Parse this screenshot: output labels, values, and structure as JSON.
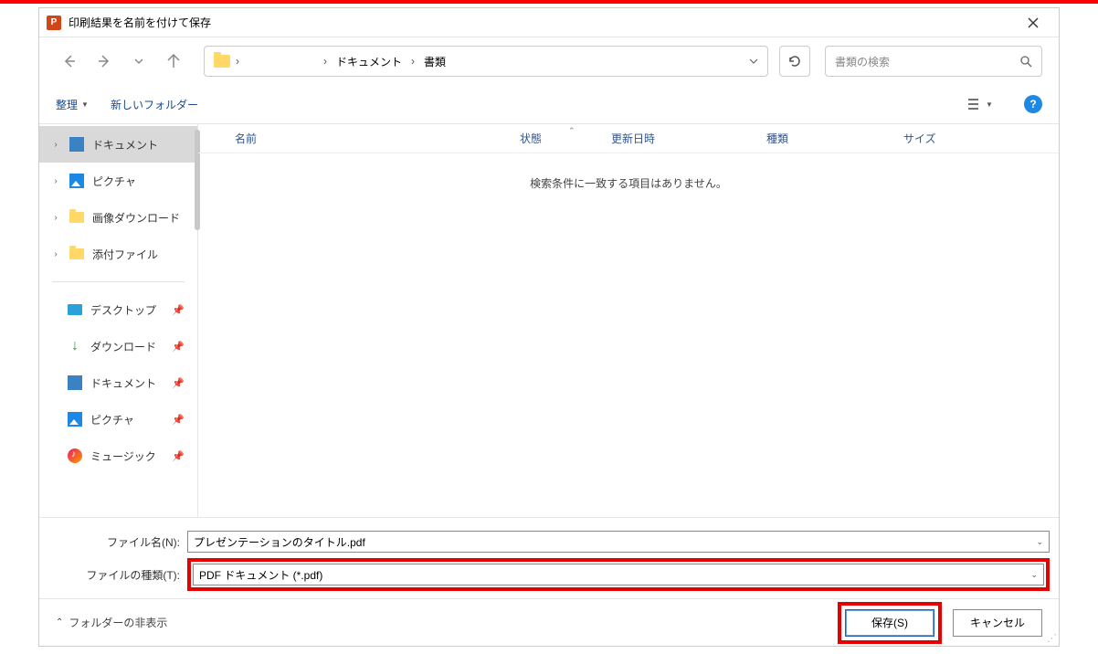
{
  "titlebar": {
    "app_icon_letter": "P",
    "title": "印刷結果を名前を付けて保存"
  },
  "breadcrumb": {
    "parts": [
      "ドキュメント",
      "書類"
    ]
  },
  "search": {
    "placeholder": "書類の検索"
  },
  "toolbar": {
    "organize": "整理",
    "new_folder": "新しいフォルダー"
  },
  "tree": {
    "items": [
      {
        "label": "ドキュメント",
        "icon": "doc",
        "caret": true,
        "selected": true
      },
      {
        "label": "ピクチャ",
        "icon": "pic",
        "caret": true
      },
      {
        "label": "画像ダウンロード",
        "icon": "folder",
        "caret": true
      },
      {
        "label": "添付ファイル",
        "icon": "folder",
        "caret": true
      }
    ],
    "quick": [
      {
        "label": "デスクトップ",
        "icon": "desktop"
      },
      {
        "label": "ダウンロード",
        "icon": "download"
      },
      {
        "label": "ドキュメント",
        "icon": "doc"
      },
      {
        "label": "ピクチャ",
        "icon": "pic"
      },
      {
        "label": "ミュージック",
        "icon": "music"
      }
    ]
  },
  "columns": {
    "name": "名前",
    "status": "状態",
    "date": "更新日時",
    "kind": "種類",
    "size": "サイズ"
  },
  "empty_msg": "検索条件に一致する項目はありません。",
  "form": {
    "filename_label": "ファイル名(N):",
    "filename_value": "プレゼンテーションのタイトル.pdf",
    "filetype_label": "ファイルの種類(T):",
    "filetype_value": "PDF ドキュメント (*.pdf)"
  },
  "footer": {
    "hide_folders": "フォルダーの非表示",
    "save": "保存(S)",
    "cancel": "キャンセル"
  }
}
